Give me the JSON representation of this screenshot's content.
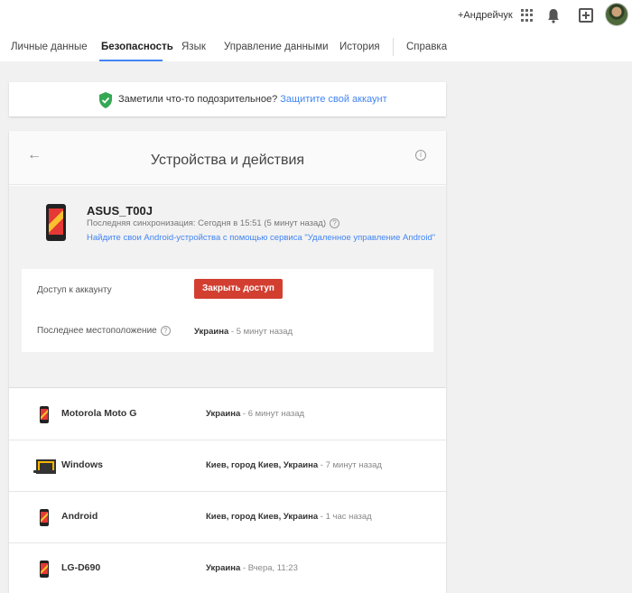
{
  "header": {
    "user_name": "+Андрейчук",
    "icons": [
      "apps-icon",
      "bell-icon",
      "share-icon",
      "avatar"
    ]
  },
  "tabs": [
    {
      "label": "Личные данные",
      "active": false
    },
    {
      "label": "Безопасность",
      "active": true
    },
    {
      "label": "Язык",
      "active": false
    },
    {
      "label": "Управление данными",
      "active": false
    },
    {
      "label": "История",
      "active": false
    },
    {
      "label": "Справка",
      "active": false
    }
  ],
  "alert": {
    "text": "Заметили что-то подозрительное?",
    "link": "Защитите свой аккаунт",
    "icon": "shield-check-icon"
  },
  "devices_card": {
    "title": "Устройства и действия",
    "current_device": {
      "name": "ASUS_T00J",
      "sync": "Последняя синхронизация: Сегодня в 15:51 (5 минут назад)",
      "find_link": "Найдите свои Android-устройства с помощью сервиса \"Удаленное управление Android\"",
      "access_label": "Доступ к аккаунту",
      "revoke_button": "Закрыть доступ",
      "location_label": "Последнее местоположение",
      "location_place": "Украина",
      "location_time": "- 5 минут назад"
    },
    "other_devices": [
      {
        "name": "Motorola Moto G",
        "place": "Украина",
        "time": "- 6 минут назад",
        "icon": "phone-icon"
      },
      {
        "name": "Windows",
        "place": "Киев, город Киев, Украина",
        "time": "- 7 минут назад",
        "icon": "laptop-icon"
      },
      {
        "name": "Android",
        "place": "Киев, город Киев, Украина",
        "time": "- 1 час назад",
        "icon": "phone-icon"
      },
      {
        "name": "LG-D690",
        "place": "Украина",
        "time": "- Вчера, 11:23",
        "icon": "phone-icon"
      }
    ]
  },
  "colors": {
    "accent": "#4285f4",
    "danger": "#d23f31",
    "shield": "#34a853"
  }
}
